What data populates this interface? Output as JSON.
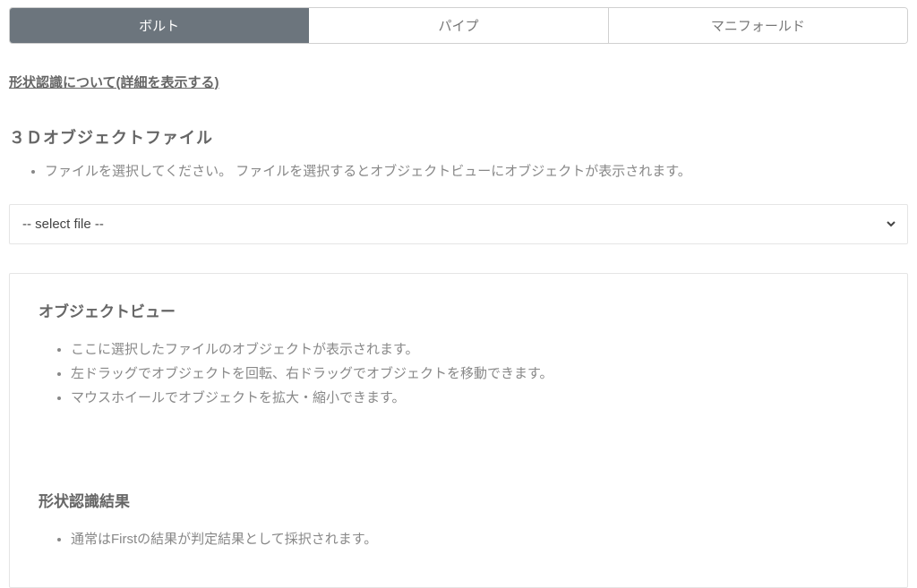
{
  "tabs": [
    {
      "label": "ボルト",
      "active": true
    },
    {
      "label": "パイプ",
      "active": false
    },
    {
      "label": "マニフォールド",
      "active": false
    }
  ],
  "about_link": "形状認識について(詳細を表示する)",
  "file_section": {
    "heading": "３Ｄオブジェクトファイル",
    "instruction": "ファイルを選択してください。 ファイルを選択するとオブジェクトビューにオブジェクトが表示されます。"
  },
  "file_select": {
    "placeholder": "-- select file --"
  },
  "object_view": {
    "heading": "オブジェクトビュー",
    "instructions": [
      "ここに選択したファイルのオブジェクトが表示されます。",
      "左ドラッグでオブジェクトを回転、右ドラッグでオブジェクトを移動できます。",
      "マウスホイールでオブジェクトを拡大・縮小できます。"
    ]
  },
  "result": {
    "heading": "形状認識結果",
    "instruction": "通常はFirstの結果が判定結果として採択されます。"
  }
}
